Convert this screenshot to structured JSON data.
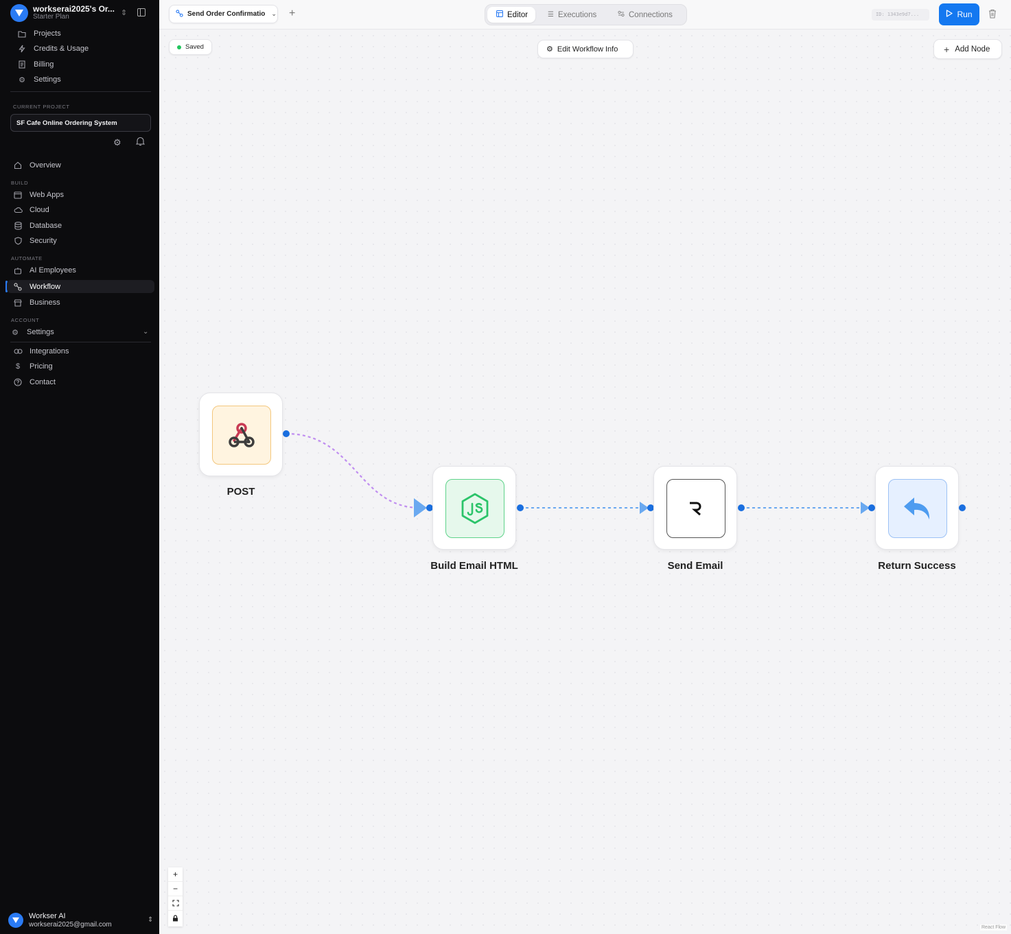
{
  "sidebar": {
    "org_name": "workserai2025's Or...",
    "org_plan": "Starter Plan",
    "top_items": [
      {
        "label": "Projects",
        "icon": "folder-icon"
      },
      {
        "label": "Credits & Usage",
        "icon": "bolt-icon"
      },
      {
        "label": "Billing",
        "icon": "receipt-icon"
      },
      {
        "label": "Settings",
        "icon": "gear-icon"
      }
    ],
    "current_project_label": "CURRENT PROJECT",
    "current_project": "SF Cafe Online Ordering System",
    "overview": "Overview",
    "build_label": "BUILD",
    "build_items": [
      "Web Apps",
      "Cloud",
      "Database",
      "Security"
    ],
    "automate_label": "AUTOMATE",
    "automate_items": [
      "AI Employees",
      "Workflow",
      "Business"
    ],
    "account_label": "ACCOUNT",
    "account_settings": "Settings",
    "footer_items": [
      "Integrations",
      "Pricing",
      "Contact"
    ],
    "user_name": "Workser AI",
    "user_email": "workserai2025@gmail.com"
  },
  "topbar": {
    "workflow_tab": "Send Order Confirmatio",
    "tabs": [
      "Editor",
      "Executions",
      "Connections"
    ],
    "active_tab": "Editor",
    "id_text": "ID: 1343e9d7...",
    "run_label": "Run"
  },
  "canvas": {
    "saved_label": "Saved",
    "edit_info_label": "Edit Workflow Info",
    "add_node_label": "Add Node",
    "attribution": "React Flow"
  },
  "nodes": [
    {
      "label": "POST",
      "icon": "webhook-icon",
      "bg": "#fff4e0",
      "border": "#f3c77e"
    },
    {
      "label": "Build Email HTML",
      "icon": "nodejs-icon",
      "bg": "#e6f8ec",
      "border": "#5fd38a"
    },
    {
      "label": "Send Email",
      "icon": "resend-icon",
      "bg": "#ffffff",
      "border": "#555555"
    },
    {
      "label": "Return Success",
      "icon": "reply-icon",
      "bg": "#e6f0ff",
      "border": "#9cc1f5"
    }
  ],
  "colors": {
    "accent": "#1478f0",
    "edge_first": "#c08ef0",
    "edge": "#6aa9f0",
    "handle": "#1a6fe0",
    "sidebar_bg": "#0c0c0e"
  }
}
